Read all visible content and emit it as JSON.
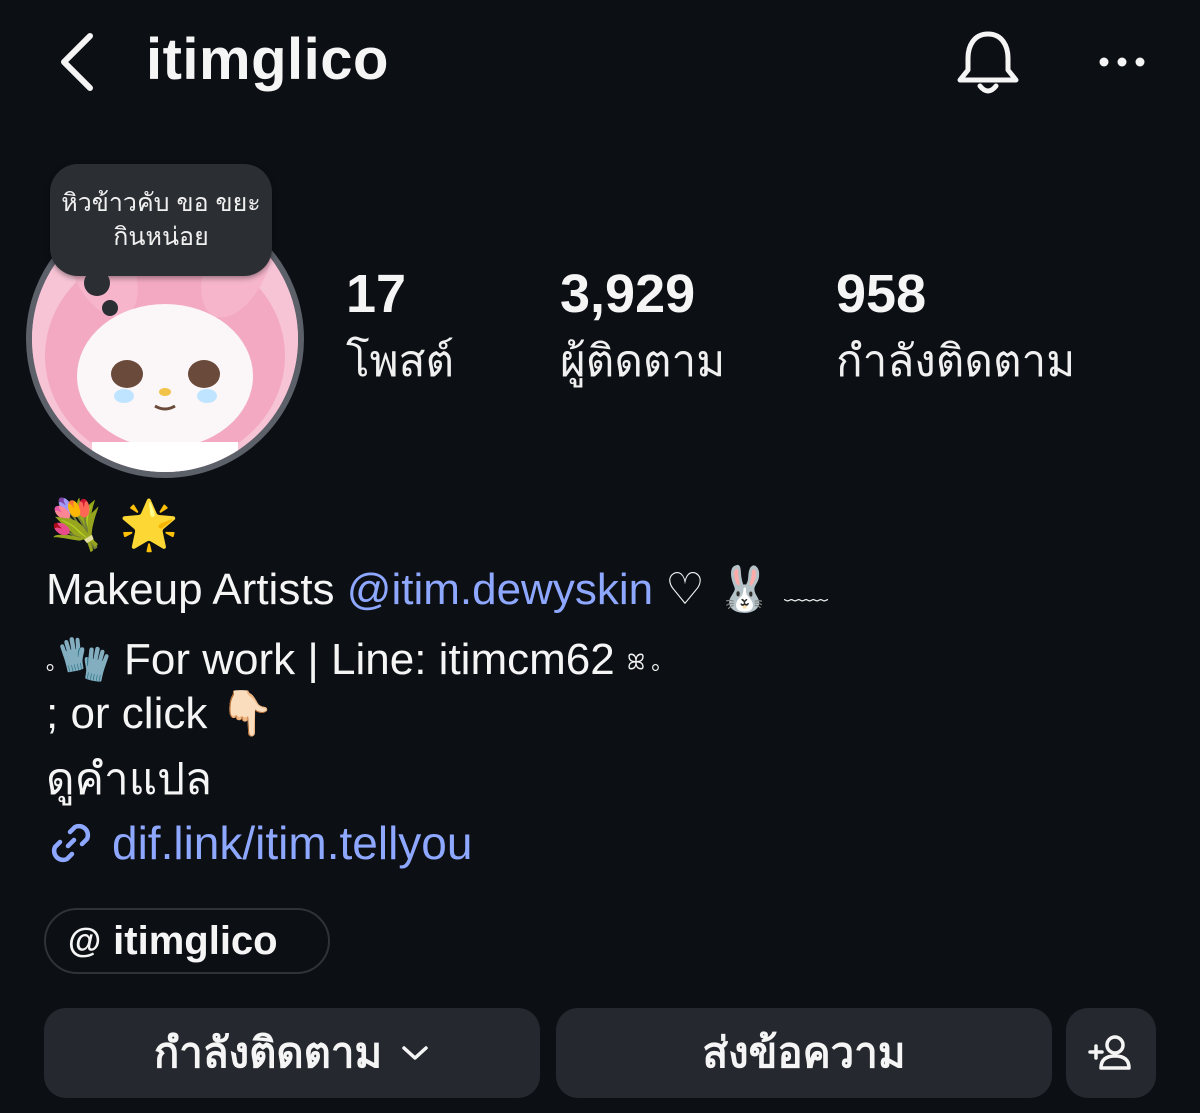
{
  "header": {
    "username": "itimglico"
  },
  "profile": {
    "note": "หิวข้าวคับ ขอ ขยะกินหน่อย",
    "stats": [
      {
        "value": "17",
        "label": "โพสต์"
      },
      {
        "value": "3,929",
        "label": "ผู้ติดตาม"
      },
      {
        "value": "958",
        "label": "กำลังติดตาม"
      }
    ]
  },
  "bio": {
    "emoji_line": "💐 🌟",
    "line1_prefix": "Makeup Artists ",
    "mention": "@itim.dewyskin",
    "line1_suffix": " ♡ 🐰 ",
    "line1_tail": "﹏﹏",
    "line2_lead": "｡",
    "line2_main": "🧤 For work | Line: itimcm62 ",
    "line2_tail": "ꕤ ｡",
    "line3": "; or click 👇🏻",
    "translate": "ดูคำแปล",
    "link": "dif.link/itim.tellyou"
  },
  "threads": {
    "icon": "threads-icon",
    "handle": "itimglico"
  },
  "actions": {
    "following": "กำลังติดตาม",
    "message": "ส่งข้อความ"
  },
  "colors": {
    "background": "#0c0f14",
    "link": "#8ea7ff",
    "button": "#25282e"
  }
}
